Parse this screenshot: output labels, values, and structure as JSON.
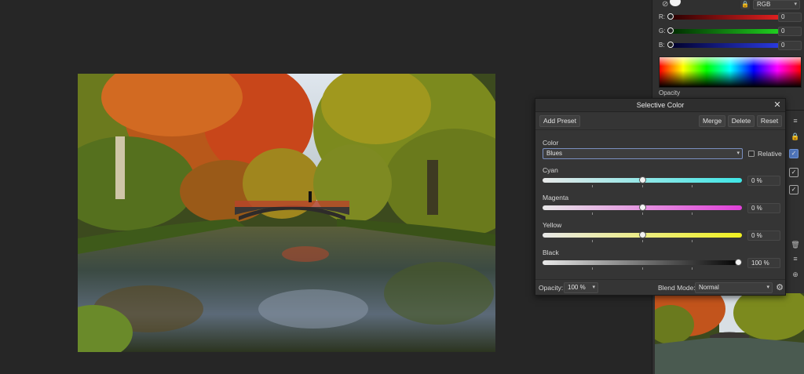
{
  "color_panel": {
    "mode": "RGB",
    "channels": [
      {
        "label": "R:",
        "value": "0",
        "color": "#e02020"
      },
      {
        "label": "G:",
        "value": "0",
        "color": "#20d020"
      },
      {
        "label": "B:",
        "value": "0",
        "color": "#2a3ae0"
      }
    ],
    "opacity_label": "Opacity"
  },
  "dialog": {
    "title": "Selective Color",
    "add_preset": "Add Preset",
    "merge": "Merge",
    "delete": "Delete",
    "reset": "Reset",
    "color_label": "Color",
    "color_value": "Blues",
    "relative_label": "Relative",
    "sliders": [
      {
        "label": "Cyan",
        "value": "0 %",
        "level": 0.5,
        "color": "#3fe6e6"
      },
      {
        "label": "Magenta",
        "value": "0 %",
        "level": 0.5,
        "color": "#e040d8"
      },
      {
        "label": "Yellow",
        "value": "0 %",
        "level": 0.5,
        "color": "#f0f020"
      },
      {
        "label": "Black",
        "value": "100 %",
        "level": 1.0,
        "color": "#000000"
      }
    ],
    "opacity_label": "Opacity:",
    "opacity_value": "100 %",
    "blend_label": "Blend Mode:",
    "blend_value": "Normal"
  }
}
